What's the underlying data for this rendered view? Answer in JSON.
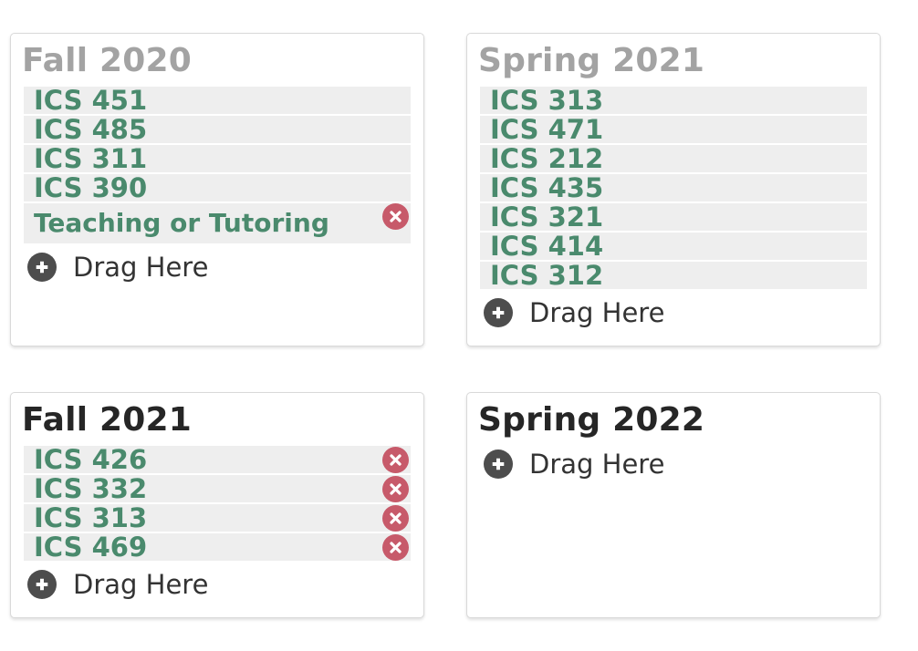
{
  "semesters": [
    {
      "title": "Fall 2020",
      "status": "past",
      "courses": [
        {
          "label": "ICS 451",
          "removable": false
        },
        {
          "label": "ICS 485",
          "removable": false
        },
        {
          "label": "ICS 311",
          "removable": false
        },
        {
          "label": "ICS 390",
          "removable": false
        },
        {
          "label": "Teaching or Tutoring",
          "removable": true
        }
      ],
      "drop_label": "Drag Here"
    },
    {
      "title": "Spring 2021",
      "status": "past",
      "courses": [
        {
          "label": "ICS 313",
          "removable": false
        },
        {
          "label": "ICS 471",
          "removable": false
        },
        {
          "label": "ICS 212",
          "removable": false
        },
        {
          "label": "ICS 435",
          "removable": false
        },
        {
          "label": "ICS 321",
          "removable": false
        },
        {
          "label": "ICS 414",
          "removable": false
        },
        {
          "label": "ICS 312",
          "removable": false
        }
      ],
      "drop_label": "Drag Here"
    },
    {
      "title": "Fall 2021",
      "status": "future",
      "courses": [
        {
          "label": "ICS 426",
          "removable": true
        },
        {
          "label": "ICS 332",
          "removable": true
        },
        {
          "label": "ICS 313",
          "removable": true
        },
        {
          "label": "ICS 469",
          "removable": true
        }
      ],
      "drop_label": "Drag Here"
    },
    {
      "title": "Spring 2022",
      "status": "future",
      "courses": [],
      "drop_label": "Drag Here"
    }
  ],
  "colors": {
    "course_text": "#4a8a6d",
    "course_bg": "#eeeeee",
    "remove_button": "#c75a6a",
    "past_title": "#a3a3a3",
    "future_title": "#262626",
    "plus_icon": "#4d4d4d"
  },
  "icons": {
    "remove": "close-circle-icon",
    "add": "plus-circle-icon"
  }
}
